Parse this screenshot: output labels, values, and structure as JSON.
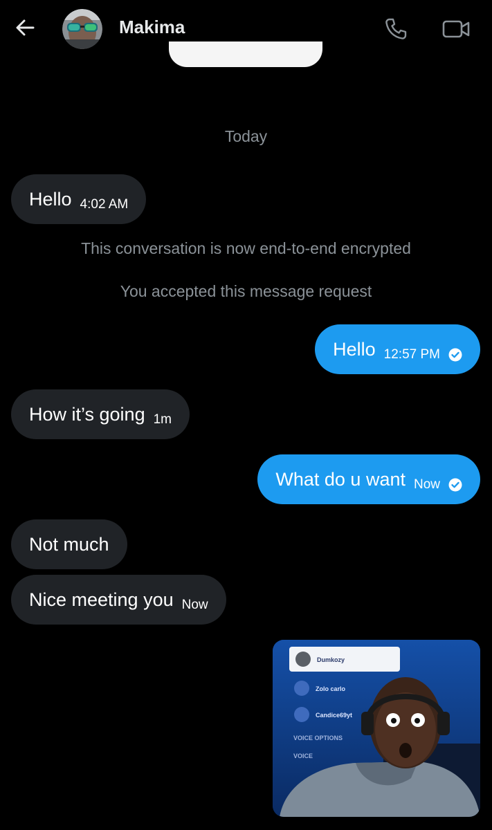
{
  "header": {
    "contact_name": "Makima",
    "icons": {
      "back": "arrow-left-icon",
      "call": "phone-icon",
      "video": "video-camera-icon"
    }
  },
  "conversation": {
    "date_separator": "Today",
    "system_messages": [
      "This conversation is now end-to-end encrypted",
      "You accepted this message request"
    ],
    "messages": [
      {
        "direction": "incoming",
        "text": "Hello",
        "time": "4:02 AM"
      },
      {
        "direction": "outgoing",
        "text": "Hello",
        "time": "12:57 PM",
        "status": "seen"
      },
      {
        "direction": "incoming",
        "text": "How it’s going",
        "time": "1m"
      },
      {
        "direction": "outgoing",
        "text": "What do u want",
        "time": "Now",
        "status": "seen"
      },
      {
        "direction": "incoming",
        "text": "Not much",
        "time": ""
      },
      {
        "direction": "incoming",
        "text": "Nice meeting you",
        "time": "Now"
      }
    ],
    "gif": {
      "type": "gif-attachment",
      "overlay_list": [
        "Dumkozy",
        "Zolo carlo",
        "Candice69yt"
      ],
      "overlay_section": "VOICE OPTIONS",
      "overlay_section_2": "VOICE"
    }
  },
  "colors": {
    "background": "#000000",
    "incoming_bubble": "#202327",
    "outgoing_bubble": "#1d9bf0",
    "system_text": "#8b9298"
  }
}
